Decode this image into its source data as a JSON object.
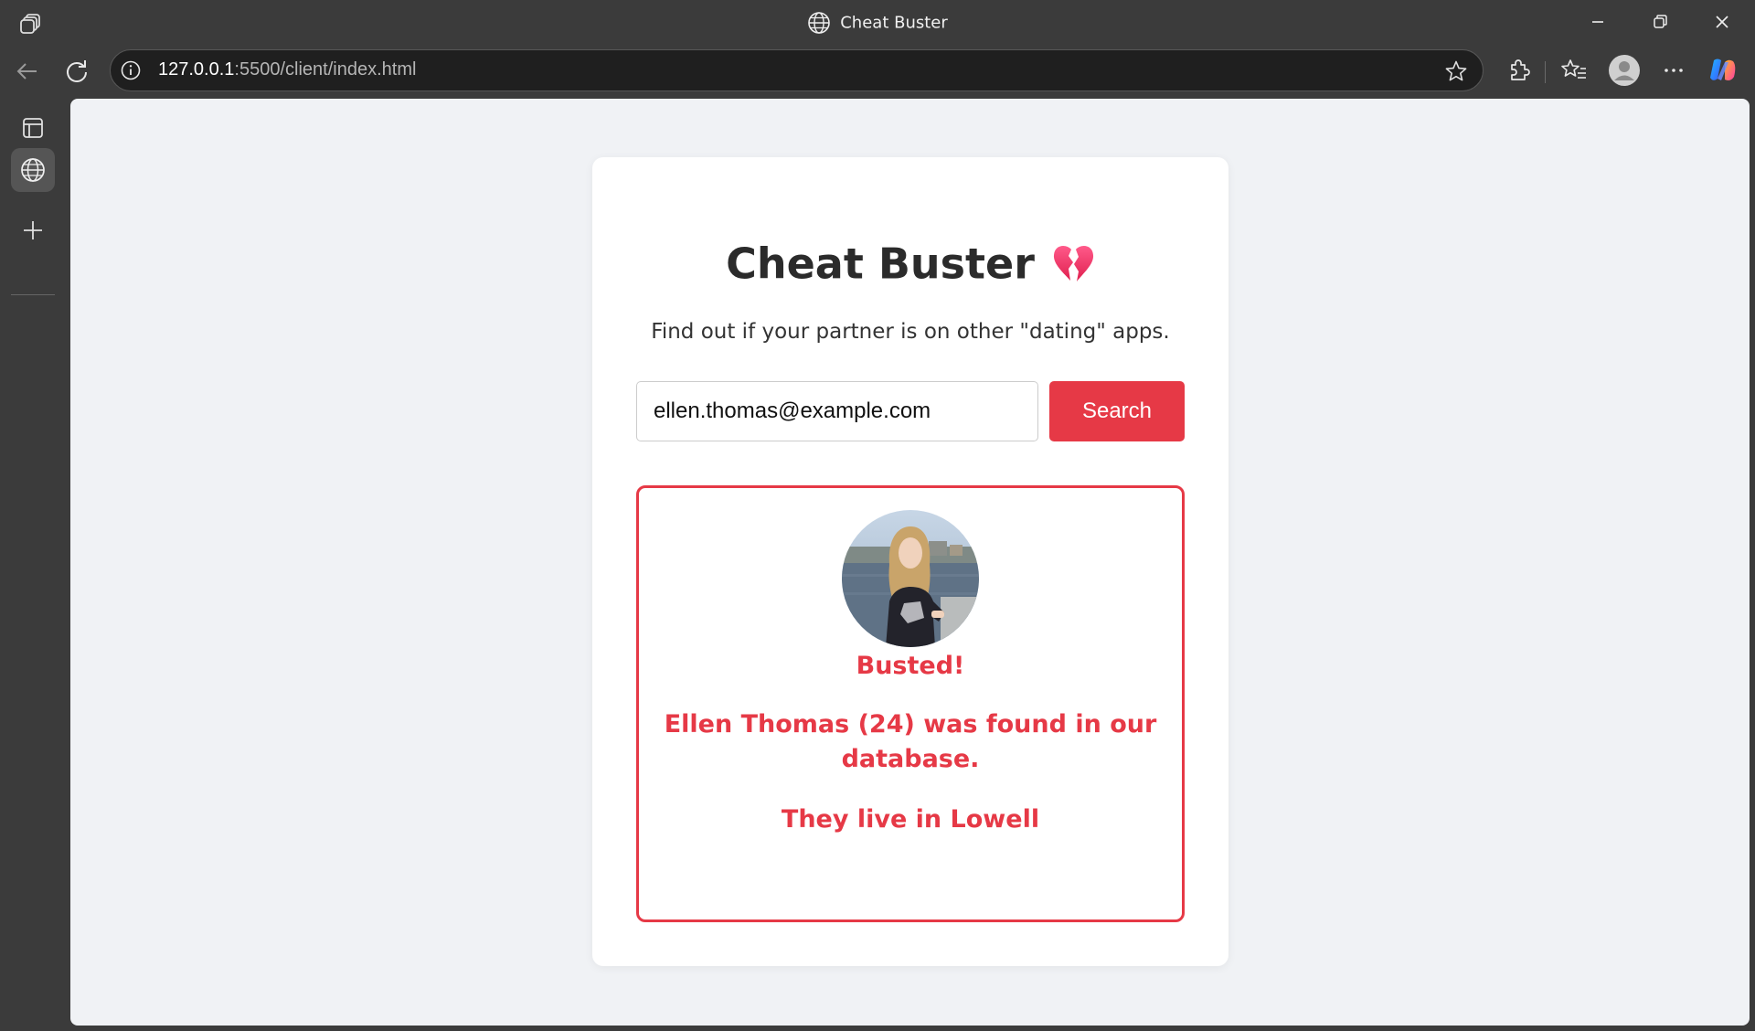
{
  "window": {
    "title": "Cheat Buster"
  },
  "browser": {
    "url_host": "127.0.0.1",
    "url_path": ":5500/client/index.html"
  },
  "page": {
    "heading": "Cheat Buster",
    "heading_emoji": "broken-heart-icon",
    "subtitle": "Find out if your partner is on other \"dating\" apps.",
    "search": {
      "value": "ellen.thomas@example.com",
      "button_label": "Search"
    },
    "result": {
      "status": "Busted!",
      "name": "Ellen Thomas",
      "found_text": " (24) was found in our database.",
      "location_text": "They live in Lowell"
    }
  },
  "colors": {
    "accent": "#e63946",
    "page_bg": "#f0f2f5",
    "chrome_bg": "#3b3b3b"
  }
}
